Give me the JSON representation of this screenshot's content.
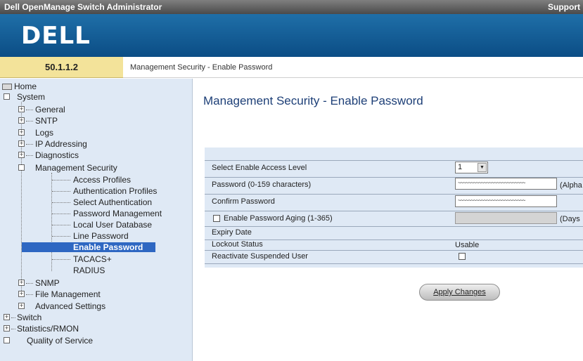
{
  "window": {
    "title": "Dell OpenManage Switch Administrator",
    "support_link": "Support"
  },
  "banner": {
    "logo_text": "DELL"
  },
  "header": {
    "ip_address": "50.1.1.2",
    "breadcrumb": "Management Security - Enable Password"
  },
  "sidebar": {
    "items": [
      {
        "label": "Home"
      },
      {
        "label": "System"
      },
      {
        "label": "General"
      },
      {
        "label": "SNTP"
      },
      {
        "label": "Logs"
      },
      {
        "label": "IP Addressing"
      },
      {
        "label": "Diagnostics"
      },
      {
        "label": "Management Security"
      },
      {
        "label": "Access Profiles"
      },
      {
        "label": "Authentication Profiles"
      },
      {
        "label": "Select Authentication"
      },
      {
        "label": "Password Management"
      },
      {
        "label": "Local User Database"
      },
      {
        "label": "Line Password"
      },
      {
        "label": "Enable Password",
        "selected": true
      },
      {
        "label": "TACACS+"
      },
      {
        "label": "RADIUS"
      },
      {
        "label": "SNMP"
      },
      {
        "label": "File Management"
      },
      {
        "label": "Advanced Settings"
      },
      {
        "label": "Switch"
      },
      {
        "label": "Statistics/RMON"
      },
      {
        "label": "Quality of Service"
      }
    ]
  },
  "main": {
    "page_title": "Management Security - Enable Password",
    "form": {
      "select_level_label": "Select Enable Access Level",
      "select_level_value": "1",
      "password_label": "Password (0-159 characters)",
      "password_mask": "~~~~~~~~~~~~~~~~~~~~~~~~~~",
      "password_unit": "(Alpha",
      "confirm_label": "Confirm Password",
      "confirm_mask": "~~~~~~~~~~~~~~~~~~~~~~~~~~",
      "aging_label": "Enable Password Aging (1-365)",
      "aging_value": "",
      "aging_unit": "(Days",
      "expiry_label": "Expiry Date",
      "lockout_label": "Lockout Status",
      "lockout_value": "Usable",
      "reactivate_label": "Reactivate Suspended User"
    },
    "apply_button": "Apply Changes"
  }
}
